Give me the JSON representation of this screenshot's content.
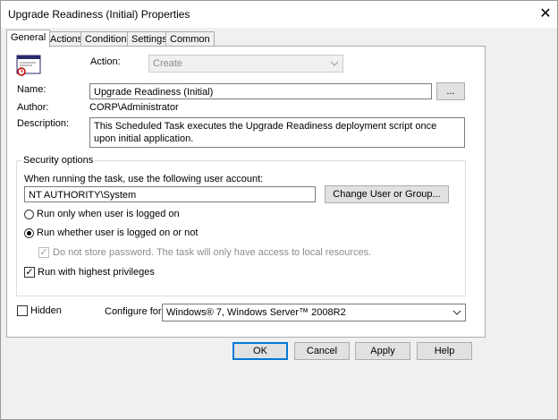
{
  "window": {
    "title": "Upgrade Readiness (Initial) Properties",
    "close_glyph": "✕"
  },
  "tabs": [
    {
      "label": "General",
      "active": true
    },
    {
      "label": "Actions"
    },
    {
      "label": "Conditions"
    },
    {
      "label": "Settings"
    },
    {
      "label": "Common"
    }
  ],
  "general": {
    "action_label": "Action:",
    "action_value": "Create",
    "name_label": "Name:",
    "name_value": "Upgrade Readiness (Initial)",
    "browse_label": "...",
    "author_label": "Author:",
    "author_value": "CORP\\Administrator",
    "description_label": "Description:",
    "description_value": "This Scheduled Task executes the Upgrade Readiness deployment script once upon initial application.",
    "security": {
      "title": "Security options",
      "account_prompt": "When running the task, use the following user account:",
      "account_value": "NT AUTHORITY\\System",
      "change_user_label": "Change User or Group...",
      "radio_logged_on": "Run only when user is logged on",
      "radio_whether": "Run whether user is logged on or not",
      "no_store_password": "Do not store password. The task will only have access to local resources.",
      "highest_privileges": "Run with highest privileges"
    },
    "hidden_label": "Hidden",
    "configure_label": "Configure for:",
    "configure_value": "Windows® 7, Windows Server™ 2008R2"
  },
  "buttons": {
    "ok": "OK",
    "cancel": "Cancel",
    "apply": "Apply",
    "help": "Help"
  },
  "colors": {
    "accent": "#0078d7",
    "disabled_text": "#8c8c8c"
  }
}
